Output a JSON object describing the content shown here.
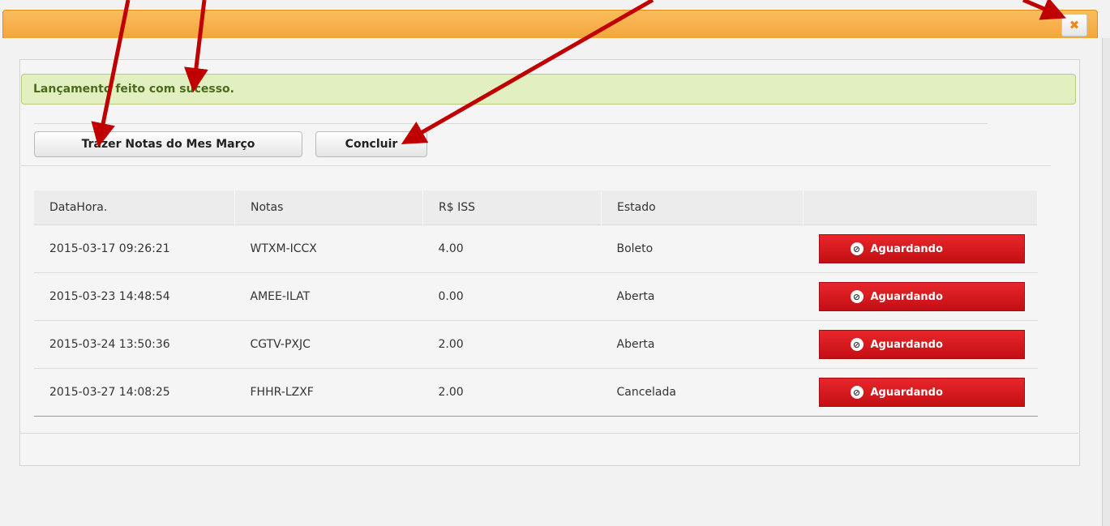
{
  "dialog": {
    "close_icon": "close-icon",
    "close_glyph": "✖"
  },
  "alert": {
    "message": "Lançamento feito com sucesso."
  },
  "toolbar": {
    "trazer_label": "Trazer Notas do Mes Março",
    "concluir_label": "Concluir"
  },
  "table": {
    "headers": [
      "DataHora.",
      "Notas",
      "R$ ISS",
      "Estado",
      ""
    ],
    "rows": [
      {
        "datahora": "2015-03-17 09:26:21",
        "nota": "WTXM-ICCX",
        "iss": "4.00",
        "estado": "Boleto",
        "acao": "Aguardando"
      },
      {
        "datahora": "2015-03-23 14:48:54",
        "nota": "AMEE-ILAT",
        "iss": "0.00",
        "estado": "Aberta",
        "acao": "Aguardando"
      },
      {
        "datahora": "2015-03-24 13:50:36",
        "nota": "CGTV-PXJC",
        "iss": "2.00",
        "estado": "Aberta",
        "acao": "Aguardando"
      },
      {
        "datahora": "2015-03-27 14:08:25",
        "nota": "FHHR-LZXF",
        "iss": "2.00",
        "estado": "Cancelada",
        "acao": "Aguardando"
      }
    ],
    "badge_icon": "ban-icon",
    "badge_glyph": "⊘"
  },
  "colors": {
    "titlebar": "#f4a53d",
    "alert_bg": "#e2efc0",
    "badge_red": "#d11a1f",
    "annotation_arrow": "#c00000"
  }
}
